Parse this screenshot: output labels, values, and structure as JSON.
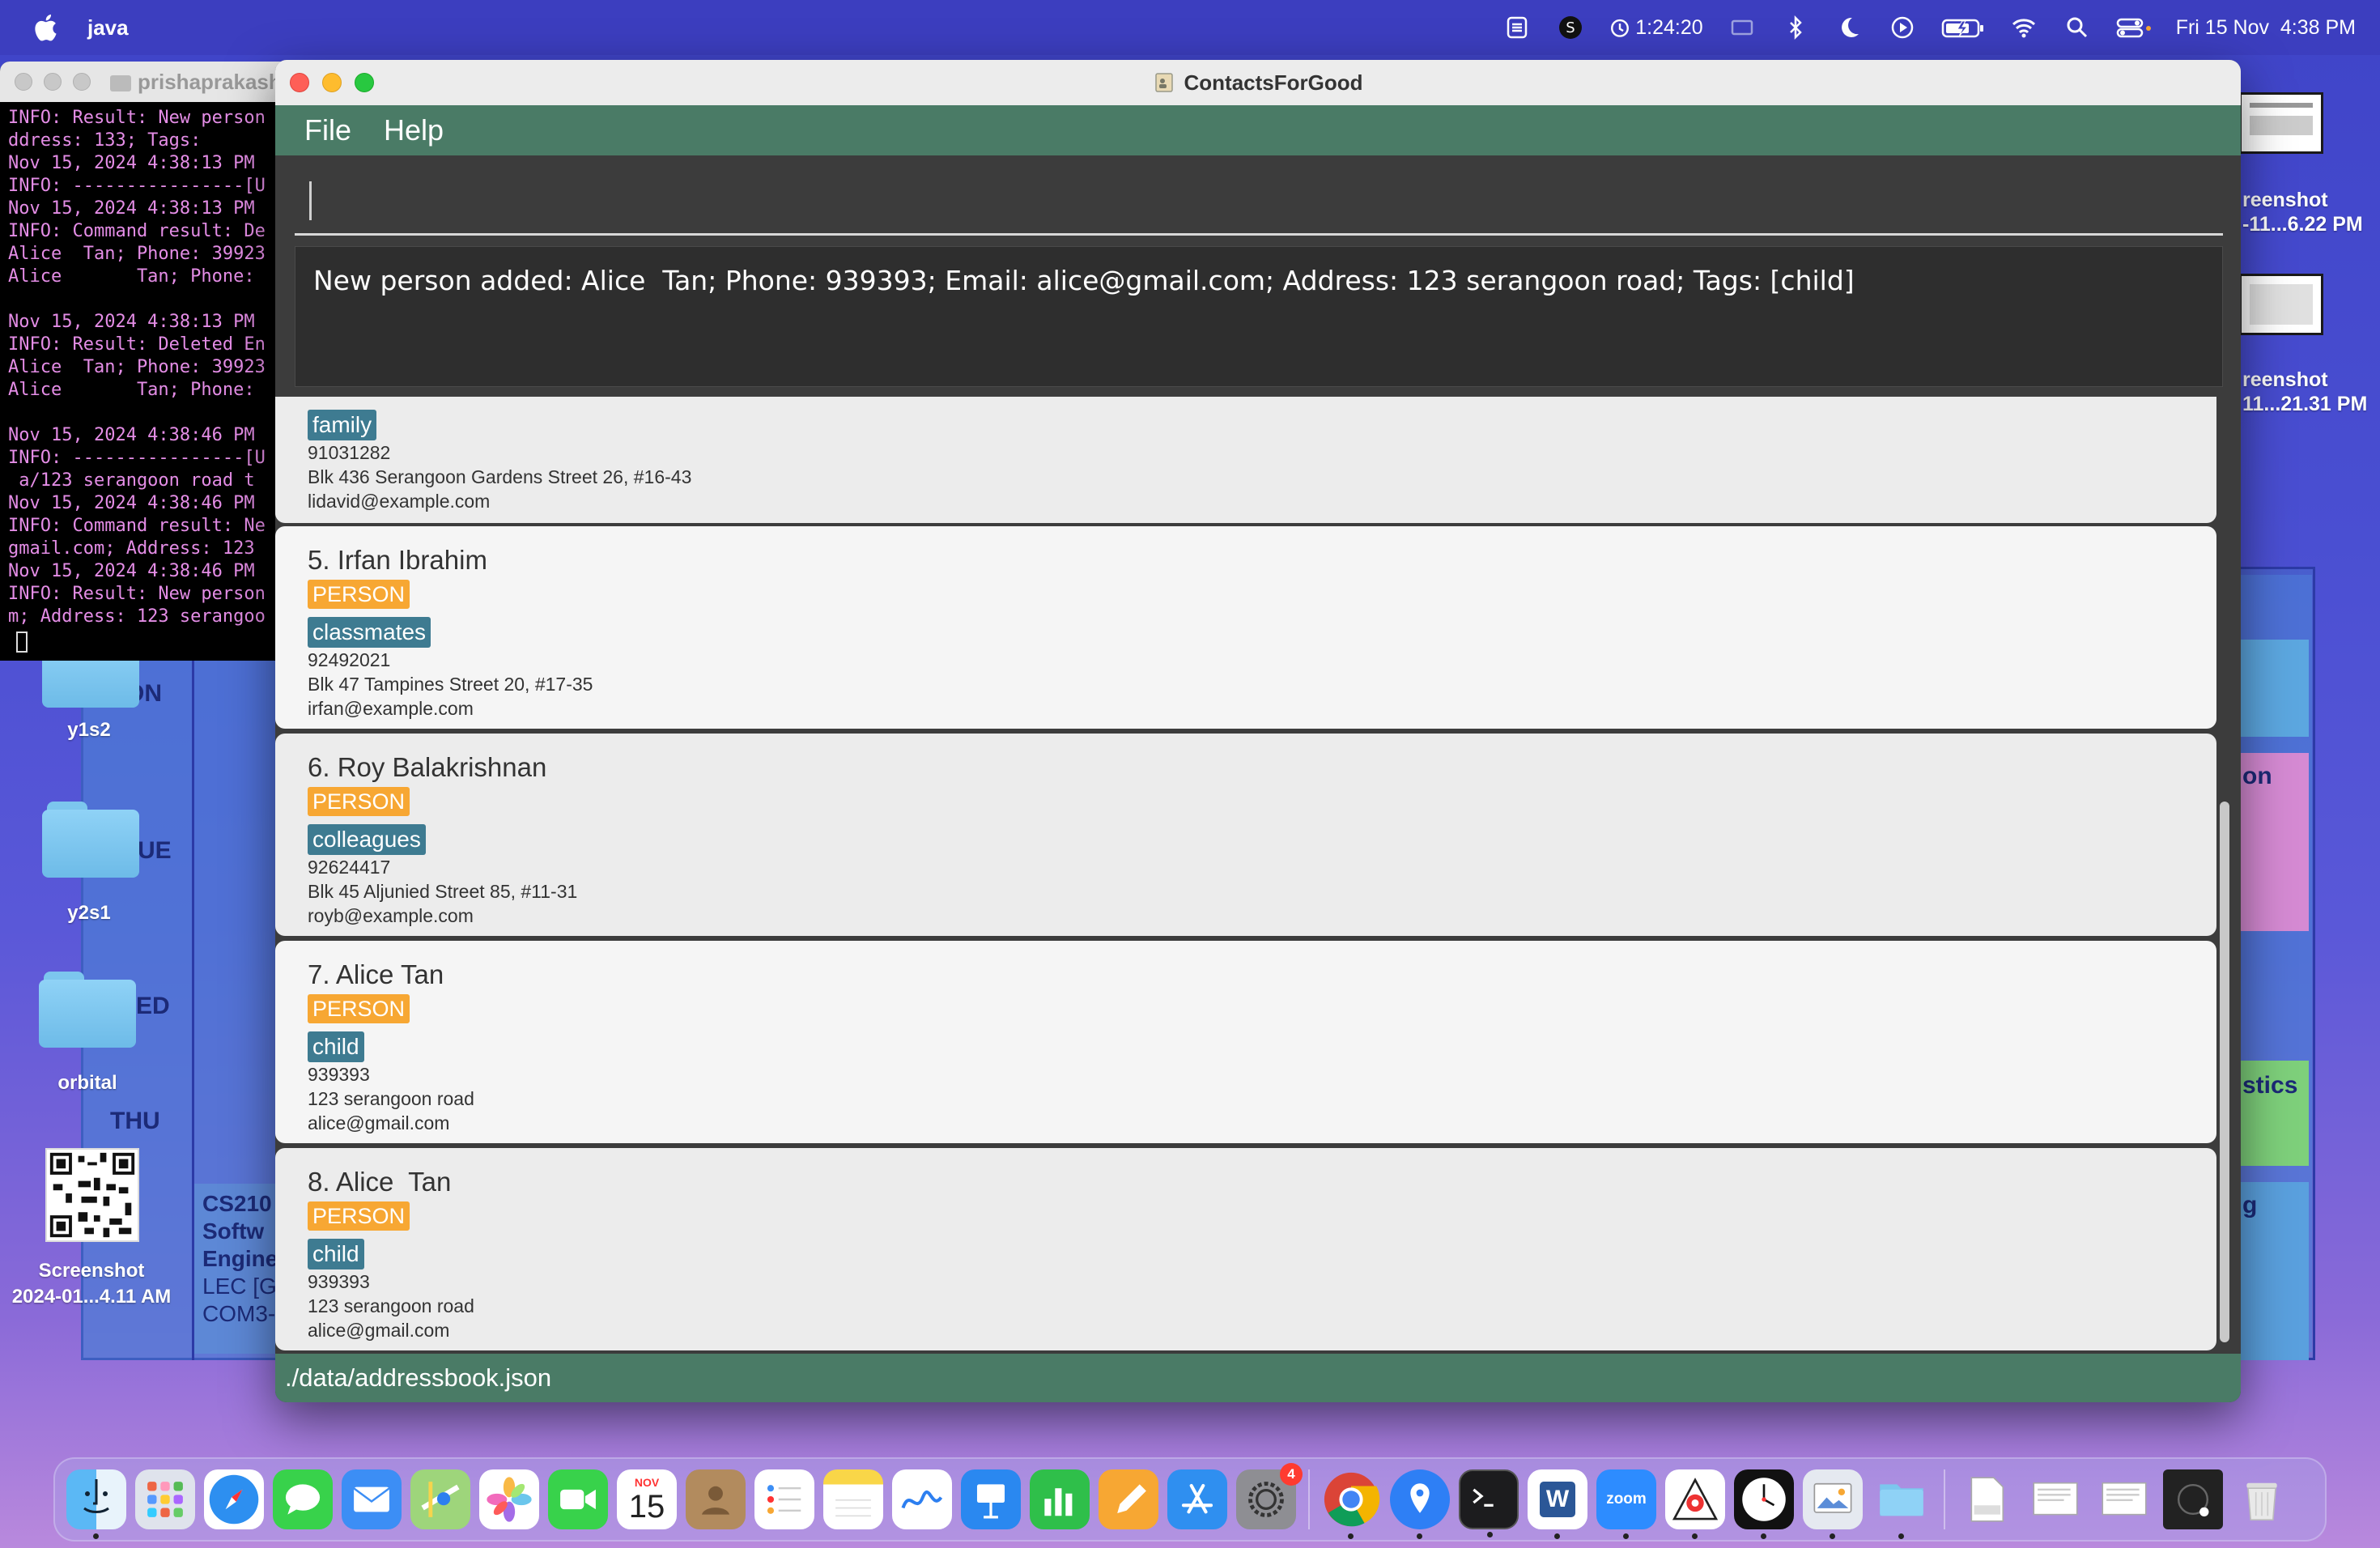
{
  "menubar": {
    "app_name": "java",
    "timer": "1:24:20",
    "datetime": "Fri 15 Nov  4:38 PM",
    "status_icons": [
      "vpn-icon",
      "skype-icon",
      "timer-icon",
      "display-icon",
      "bluetooth-icon",
      "moon-icon",
      "play-icon",
      "battery-icon",
      "wifi-icon",
      "search-icon",
      "control-center-icon"
    ]
  },
  "terminal": {
    "title": "prishaprakash",
    "lines": [
      "INFO: Result: New person",
      "ddress: 133; Tags:",
      "Nov 15, 2024 4:38:13 PM",
      "INFO: ----------------[U",
      "Nov 15, 2024 4:38:13 PM",
      "INFO: Command result: De",
      "Alice  Tan; Phone: 39923",
      "Alice       Tan; Phone:",
      "",
      "Nov 15, 2024 4:38:13 PM",
      "INFO: Result: Deleted En",
      "Alice  Tan; Phone: 39923",
      "Alice       Tan; Phone:",
      "",
      "Nov 15, 2024 4:38:46 PM",
      "INFO: ----------------[U",
      " a/123 serangoon road t",
      "Nov 15, 2024 4:38:46 PM",
      "INFO: Command result: Ne",
      "gmail.com; Address: 123",
      "Nov 15, 2024 4:38:46 PM",
      "INFO: Result: New person",
      "m; Address: 123 serangoo"
    ]
  },
  "desktop": {
    "folders": [
      "y1s2",
      "y2s1",
      "orbital"
    ],
    "calendar_text": [
      "MON",
      "UE",
      "ED",
      "THU",
      "on",
      "stics",
      "g"
    ],
    "course_card": [
      "CS210",
      "Softw",
      "Engine",
      "LEC [G",
      "COM3-"
    ],
    "qr_label": [
      "Screenshot",
      "2024-01...4.11 AM"
    ],
    "screenshot_labels": [
      [
        "reenshot",
        "-11...6.22 PM"
      ],
      [
        "reenshot",
        "11...21.31 PM"
      ]
    ]
  },
  "app": {
    "window_title": "ContactsForGood",
    "menu": {
      "file": "File",
      "help": "Help"
    },
    "command_value": "",
    "result_text": "New person added: Alice  Tan; Phone: 939393; Email: alice@gmail.com; Address: 123 serangoon road; Tags: [child]",
    "status_path": "./data/addressbook.json",
    "partial_card": {
      "tag": "family",
      "phone": "91031282",
      "address": "Blk 436 Serangoon Gardens Street 26, #16-43",
      "email": "lidavid@example.com"
    },
    "contacts": [
      {
        "name": "5. Irfan Ibrahim",
        "type": "PERSON",
        "tag": "classmates",
        "phone": "92492021",
        "address": "Blk 47 Tampines Street 20, #17-35",
        "email": "irfan@example.com"
      },
      {
        "name": "6. Roy Balakrishnan",
        "type": "PERSON",
        "tag": "colleagues",
        "phone": "92624417",
        "address": "Blk 45 Aljunied Street 85, #11-31",
        "email": "royb@example.com"
      },
      {
        "name": "7. Alice Tan",
        "type": "PERSON",
        "tag": "child",
        "phone": "939393",
        "address": "123 serangoon road",
        "email": "alice@gmail.com"
      },
      {
        "name": "8. Alice  Tan",
        "type": "PERSON",
        "tag": "child",
        "phone": "939393",
        "address": "123 serangoon road",
        "email": "alice@gmail.com"
      }
    ]
  },
  "dock": {
    "calendar_month": "NOV",
    "calendar_day": "15",
    "settings_badge": "4",
    "zoom_label": "zoom",
    "word_label": "W",
    "apps": [
      "finder",
      "launchpad",
      "safari",
      "messages",
      "mail",
      "maps",
      "photos",
      "facetime",
      "calendar",
      "contacts",
      "reminders",
      "notes",
      "freeform",
      "keynote",
      "numbers",
      "pages",
      "app-store",
      "system-settings",
      "chrome",
      "vpn",
      "terminal",
      "word",
      "zoom",
      "java",
      "clock",
      "preview",
      "folder",
      "png-file",
      "doc-file",
      "doc-file-2",
      "screenshot-file",
      "trash"
    ]
  }
}
